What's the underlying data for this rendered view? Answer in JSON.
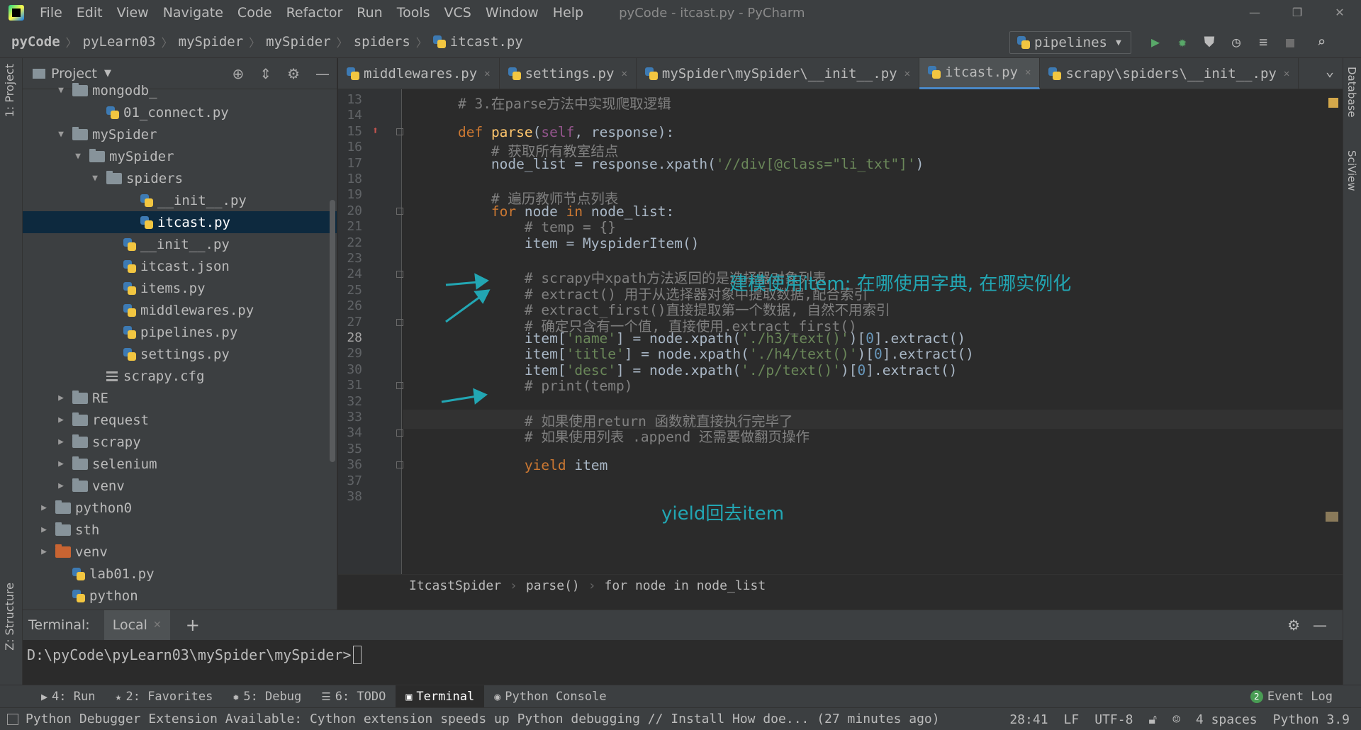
{
  "menu": [
    "File",
    "Edit",
    "View",
    "Navigate",
    "Code",
    "Refactor",
    "Run",
    "Tools",
    "VCS",
    "Window",
    "Help"
  ],
  "window_title": "pyCode - itcast.py - PyCharm",
  "breadcrumb": [
    "pyCode",
    "pyLearn03",
    "mySpider",
    "mySpider",
    "spiders",
    "itcast.py"
  ],
  "run_config": "pipelines",
  "left_tabs": {
    "project": "1: Project",
    "structure": "Z: Structure"
  },
  "right_tabs": {
    "database": "Database",
    "sciview": "SciView"
  },
  "project_panel": {
    "title": "Project"
  },
  "tree": [
    {
      "label": "mongodb_",
      "kind": "folder",
      "indent": 1,
      "arrow": "open"
    },
    {
      "label": "01_connect.py",
      "kind": "py",
      "indent": 3
    },
    {
      "label": "mySpider",
      "kind": "folder",
      "indent": 1,
      "arrow": "open"
    },
    {
      "label": "mySpider",
      "kind": "folder",
      "indent": 2,
      "arrow": "open"
    },
    {
      "label": "spiders",
      "kind": "folder",
      "indent": 3,
      "arrow": "open"
    },
    {
      "label": "__init__.py",
      "kind": "py",
      "indent": 5
    },
    {
      "label": "itcast.py",
      "kind": "py",
      "indent": 5,
      "selected": true
    },
    {
      "label": "__init__.py",
      "kind": "py",
      "indent": 4
    },
    {
      "label": "itcast.json",
      "kind": "py",
      "indent": 4
    },
    {
      "label": "items.py",
      "kind": "py",
      "indent": 4
    },
    {
      "label": "middlewares.py",
      "kind": "py",
      "indent": 4
    },
    {
      "label": "pipelines.py",
      "kind": "py",
      "indent": 4
    },
    {
      "label": "settings.py",
      "kind": "py",
      "indent": 4
    },
    {
      "label": "scrapy.cfg",
      "kind": "cfg",
      "indent": 3
    },
    {
      "label": "RE",
      "kind": "folder",
      "indent": 1,
      "arrow": "closed"
    },
    {
      "label": "request",
      "kind": "folder",
      "indent": 1,
      "arrow": "closed"
    },
    {
      "label": "scrapy",
      "kind": "folder",
      "indent": 1,
      "arrow": "closed"
    },
    {
      "label": "selenium",
      "kind": "folder",
      "indent": 1,
      "arrow": "closed"
    },
    {
      "label": "venv",
      "kind": "folder",
      "indent": 1,
      "arrow": "closed"
    },
    {
      "label": "python0",
      "kind": "folder",
      "indent": 0,
      "arrow": "closed"
    },
    {
      "label": "sth",
      "kind": "folder",
      "indent": 0,
      "arrow": "closed"
    },
    {
      "label": "venv",
      "kind": "folder-orange",
      "indent": 0,
      "arrow": "closed"
    },
    {
      "label": "lab01.py",
      "kind": "py",
      "indent": 1
    },
    {
      "label": "python",
      "kind": "py",
      "indent": 1
    }
  ],
  "editor_tabs": [
    {
      "label": "middlewares.py"
    },
    {
      "label": "settings.py"
    },
    {
      "label": "mySpider\\mySpider\\__init__.py"
    },
    {
      "label": "itcast.py",
      "active": true
    },
    {
      "label": "scrapy\\spiders\\__init__.py"
    }
  ],
  "code_lines": [
    {
      "n": "13",
      "segs": [
        [
          "    ",
          ""
        ],
        [
          "# 3.在parse方法中实现爬取逻辑",
          "cm"
        ]
      ]
    },
    {
      "n": "14",
      "segs": []
    },
    {
      "n": "15",
      "segs": [
        [
          "    ",
          ""
        ],
        [
          "def ",
          "kw"
        ],
        [
          "parse",
          "fn"
        ],
        [
          "(",
          ""
        ],
        [
          "self",
          "self"
        ],
        [
          ", response):",
          ""
        ]
      ]
    },
    {
      "n": "16",
      "segs": [
        [
          "        ",
          ""
        ],
        [
          "# 获取所有教室结点",
          "cm"
        ]
      ]
    },
    {
      "n": "17",
      "segs": [
        [
          "        node_list = response.xpath(",
          ""
        ],
        [
          "'//div[@class=\"li_txt\"]'",
          "str"
        ],
        [
          ")",
          ""
        ]
      ]
    },
    {
      "n": "18",
      "segs": []
    },
    {
      "n": "19",
      "segs": [
        [
          "        ",
          ""
        ],
        [
          "# 遍历教师节点列表",
          "cm"
        ]
      ]
    },
    {
      "n": "20",
      "segs": [
        [
          "        ",
          ""
        ],
        [
          "for ",
          "kw"
        ],
        [
          "node ",
          ""
        ],
        [
          "in ",
          "kw"
        ],
        [
          "node_list:",
          ""
        ]
      ]
    },
    {
      "n": "21",
      "segs": [
        [
          "            ",
          ""
        ],
        [
          "# temp = {}",
          "cm"
        ]
      ]
    },
    {
      "n": "22",
      "segs": [
        [
          "            item = MyspiderItem()",
          ""
        ]
      ]
    },
    {
      "n": "23",
      "segs": []
    },
    {
      "n": "24",
      "segs": [
        [
          "            ",
          ""
        ],
        [
          "# scrapy中xpath方法返回的是选择器对象列表",
          "cm"
        ]
      ]
    },
    {
      "n": "25",
      "segs": [
        [
          "            ",
          ""
        ],
        [
          "# extract() 用于从选择器对象中提取数据,配合索引",
          "cm"
        ]
      ]
    },
    {
      "n": "26",
      "segs": [
        [
          "            ",
          ""
        ],
        [
          "# extract_first()直接提取第一个数据, 自然不用索引",
          "cm"
        ]
      ]
    },
    {
      "n": "27",
      "segs": [
        [
          "            ",
          ""
        ],
        [
          "# 确定只含有一个值, 直接使用.extract_first()",
          "cm"
        ]
      ]
    },
    {
      "n": "28",
      "segs": [
        [
          "            item[",
          ""
        ],
        [
          "'name'",
          "str"
        ],
        [
          "] = node.xpath(",
          ""
        ],
        [
          "'./h3/text()'",
          "str"
        ],
        [
          ")[",
          ""
        ],
        [
          "0",
          "num"
        ],
        [
          "].extract()",
          ""
        ]
      ]
    },
    {
      "n": "29",
      "segs": [
        [
          "            item[",
          ""
        ],
        [
          "'title'",
          "str"
        ],
        [
          "] = node.xpath(",
          ""
        ],
        [
          "'./h4/text()'",
          "str"
        ],
        [
          ")[",
          ""
        ],
        [
          "0",
          "num"
        ],
        [
          "].extract()",
          ""
        ]
      ]
    },
    {
      "n": "30",
      "segs": [
        [
          "            item[",
          ""
        ],
        [
          "'desc'",
          "str"
        ],
        [
          "] = node.xpath(",
          ""
        ],
        [
          "'./p/text()'",
          "str"
        ],
        [
          ")[",
          ""
        ],
        [
          "0",
          "num"
        ],
        [
          "].extract()",
          ""
        ]
      ]
    },
    {
      "n": "31",
      "segs": [
        [
          "            ",
          ""
        ],
        [
          "# print(temp)",
          "cm"
        ]
      ]
    },
    {
      "n": "32",
      "segs": []
    },
    {
      "n": "33",
      "segs": [
        [
          "            ",
          ""
        ],
        [
          "# 如果使用return 函数就直接执行完毕了",
          "cm"
        ]
      ]
    },
    {
      "n": "34",
      "segs": [
        [
          "            ",
          ""
        ],
        [
          "# 如果使用列表 .append 还需要做翻页操作",
          "cm"
        ]
      ]
    },
    {
      "n": "35",
      "segs": []
    },
    {
      "n": "36",
      "segs": [
        [
          "            ",
          ""
        ],
        [
          "yield ",
          "kw"
        ],
        [
          "item",
          ""
        ]
      ]
    },
    {
      "n": "37",
      "segs": []
    },
    {
      "n": "38",
      "segs": []
    }
  ],
  "annotations": {
    "item_note": "建模使用item: 在哪使用字典, 在哪实例化",
    "yield_note": "yield回去item"
  },
  "editor_breadcrumb": [
    "ItcastSpider",
    "parse()",
    "for node in node_list"
  ],
  "terminal": {
    "title": "Terminal:",
    "tab": "Local",
    "prompt": "D:\\pyCode\\pyLearn03\\mySpider\\mySpider>"
  },
  "toolwindows": [
    {
      "label": "4: Run",
      "icon": "▶"
    },
    {
      "label": "2: Favorites",
      "icon": "★"
    },
    {
      "label": "5: Debug",
      "icon": "✹"
    },
    {
      "label": "6: TODO",
      "icon": "☰"
    },
    {
      "label": "Terminal",
      "icon": "▣",
      "active": true
    },
    {
      "label": "Python Console",
      "icon": "◉"
    }
  ],
  "event_log": {
    "count": "2",
    "label": "Event Log"
  },
  "status": {
    "message": "Python Debugger Extension Available: Cython extension speeds up Python debugging // Install   How doe... (27 minutes ago)",
    "position": "28:41",
    "line_sep": "LF",
    "encoding": "UTF-8",
    "indent": "4 spaces",
    "interpreter": "Python 3.9"
  }
}
